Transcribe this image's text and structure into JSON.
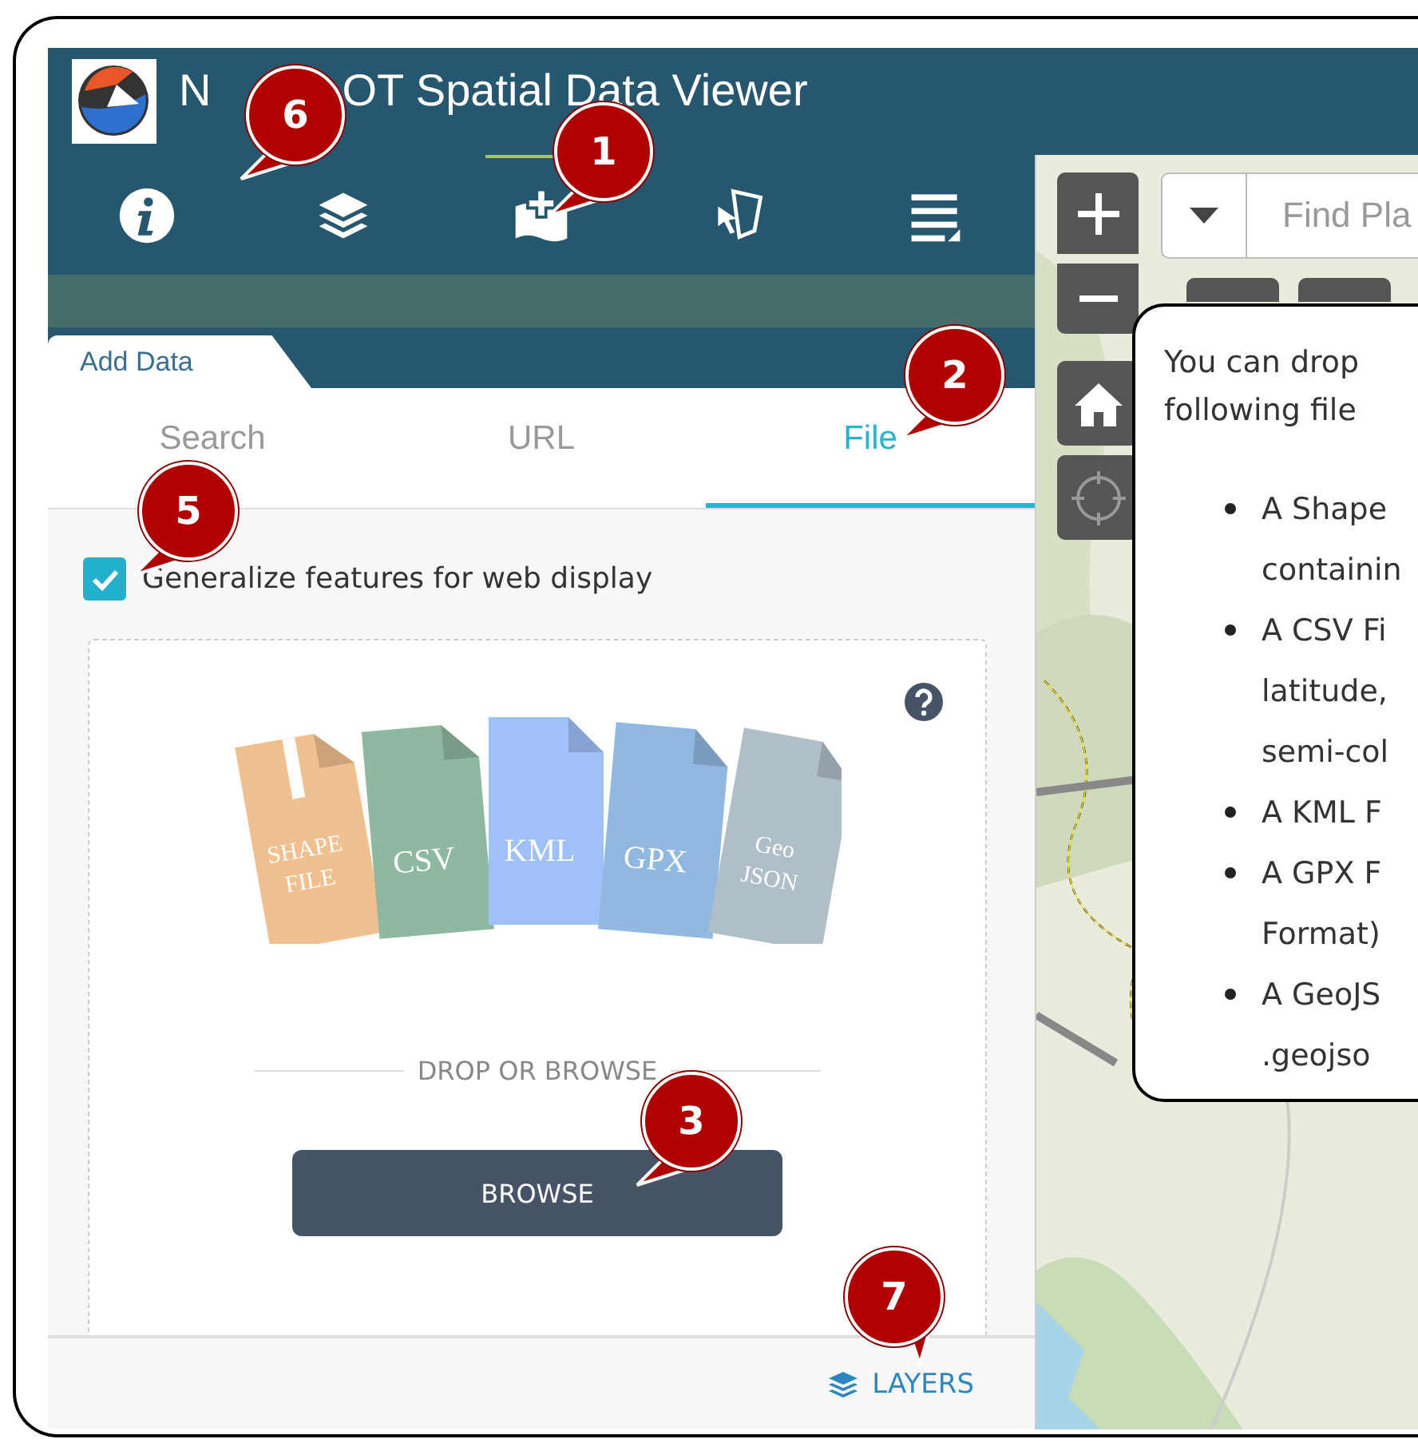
{
  "header": {
    "title_parts": [
      "N",
      "OT Spatial Data Viewer"
    ]
  },
  "toolbar": [
    {
      "kind": "info",
      "selected": false
    },
    {
      "kind": "layers",
      "selected": false
    },
    {
      "kind": "add",
      "selected": true
    },
    {
      "kind": "select",
      "selected": false
    },
    {
      "kind": "list",
      "selected": false
    }
  ],
  "panel": {
    "title": "Add Data",
    "tabs": [
      {
        "label": "Search",
        "selected": false
      },
      {
        "label": "URL",
        "selected": false
      },
      {
        "label": "File",
        "selected": true
      }
    ],
    "generalize": {
      "label": "Generalize features for web display",
      "checked": true
    },
    "file_types": [
      {
        "lines": [
          "SHAPE",
          "FILE"
        ],
        "color": "#f0c090",
        "zipper": true
      },
      {
        "lines": [
          "CSV"
        ],
        "color": "#8fb8a0",
        "zipper": false
      },
      {
        "lines": [
          "KML"
        ],
        "color": "#a0c0f8",
        "zipper": false
      },
      {
        "lines": [
          "GPX"
        ],
        "color": "#90b8e0",
        "zipper": false
      },
      {
        "lines": [
          "Geo",
          "JSON"
        ],
        "color": "#b0bec8",
        "zipper": false
      }
    ],
    "drop_label": "DROP OR BROWSE",
    "browse_button": "BROWSE",
    "footer_link": "LAYERS"
  },
  "map": {
    "search_placeholder": "Find Pla",
    "popup": {
      "intro": [
        "You can drop",
        "following file"
      ],
      "bullets": [
        {
          "lines": [
            "A Shape",
            "containin"
          ]
        },
        {
          "lines": [
            "A CSV Fi",
            "latitude,",
            "semi-col"
          ]
        },
        {
          "lines": [
            "A KML F"
          ]
        },
        {
          "lines": [
            "A GPX F",
            "Format)"
          ]
        },
        {
          "lines": [
            "A GeoJS",
            ".geojso"
          ]
        }
      ]
    }
  },
  "callouts": [
    "6",
    "1",
    "2",
    "5",
    "3",
    "7"
  ]
}
